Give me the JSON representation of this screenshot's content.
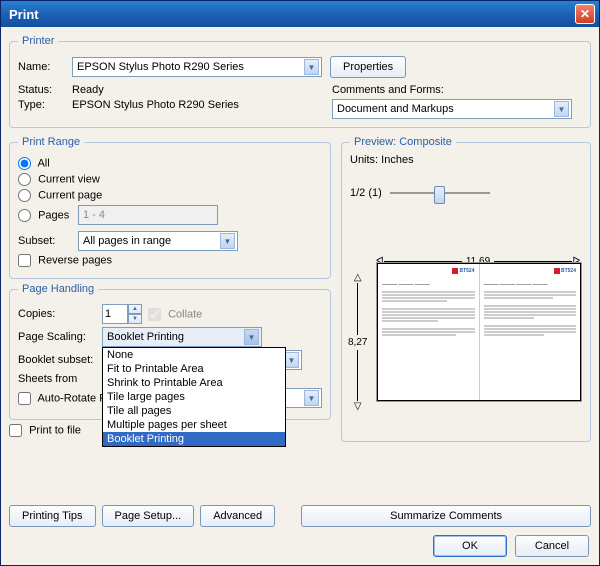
{
  "window": {
    "title": "Print"
  },
  "printer": {
    "legend": "Printer",
    "name_label": "Name:",
    "name_value": "EPSON Stylus Photo R290 Series",
    "properties_btn": "Properties",
    "status_label": "Status:",
    "status_value": "Ready",
    "type_label": "Type:",
    "type_value": "EPSON Stylus Photo R290 Series",
    "comments_label": "Comments and Forms:",
    "comments_value": "Document and Markups"
  },
  "print_range": {
    "legend": "Print Range",
    "all": "All",
    "current_view": "Current view",
    "current_page": "Current page",
    "pages": "Pages",
    "pages_value": "1 - 4",
    "subset_label": "Subset:",
    "subset_value": "All pages in range",
    "reverse_pages": "Reverse pages"
  },
  "page_handling": {
    "legend": "Page Handling",
    "copies_label": "Copies:",
    "copies_value": "1",
    "collate": "Collate",
    "page_scaling_label": "Page Scaling:",
    "page_scaling_value": "Booklet Printing",
    "booklet_subset_label": "Booklet subset:",
    "sheets_from_label": "Sheets from",
    "auto_rotate": "Auto-Rotate Pa",
    "scaling_options": [
      "None",
      "Fit to Printable Area",
      "Shrink to Printable Area",
      "Tile large pages",
      "Tile all pages",
      "Multiple pages per sheet",
      "Booklet Printing"
    ]
  },
  "print_to_file": "Print to file",
  "preview": {
    "legend": "Preview: Composite",
    "units": "Units: Inches",
    "page_indicator": "1/2 (1)",
    "width": "11,69",
    "height": "8,27",
    "logo_text": "BT524"
  },
  "buttons": {
    "printing_tips": "Printing Tips",
    "page_setup": "Page Setup...",
    "advanced": "Advanced",
    "summarize": "Summarize Comments",
    "ok": "OK",
    "cancel": "Cancel"
  }
}
